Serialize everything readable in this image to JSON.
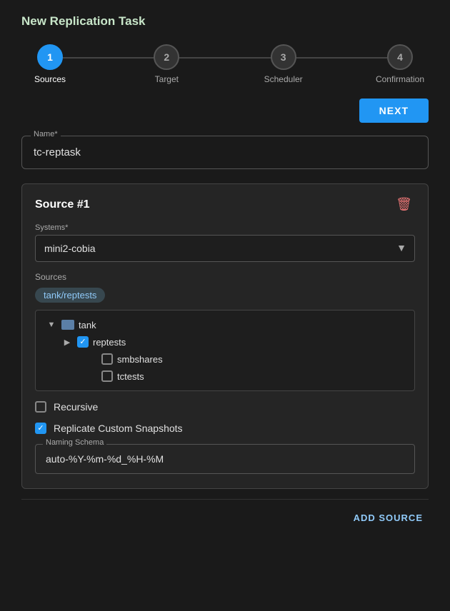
{
  "page": {
    "title": "New Replication Task"
  },
  "stepper": {
    "steps": [
      {
        "number": "1",
        "label": "Sources",
        "active": true
      },
      {
        "number": "2",
        "label": "Target",
        "active": false
      },
      {
        "number": "3",
        "label": "Scheduler",
        "active": false
      },
      {
        "number": "4",
        "label": "Confirmation",
        "active": false
      }
    ]
  },
  "toolbar": {
    "next_label": "NEXT"
  },
  "name_field": {
    "label": "Name*",
    "value": "tc-reptask"
  },
  "source_card": {
    "title": "Source #1",
    "systems_label": "Systems*",
    "systems_value": "mini2-cobia",
    "sources_label": "Sources",
    "source_tag": "tank/reptests",
    "tree": [
      {
        "level": 1,
        "toggle": "▼",
        "type": "folder",
        "label": "tank",
        "checked": false,
        "indeterminate": true
      },
      {
        "level": 2,
        "toggle": "▶",
        "type": "check",
        "label": "reptests",
        "checked": true
      },
      {
        "level": 2,
        "toggle": "",
        "type": "check",
        "label": "smbshares",
        "checked": false
      },
      {
        "level": 2,
        "toggle": "",
        "type": "check",
        "label": "tctests",
        "checked": false
      }
    ],
    "recursive_label": "Recursive",
    "recursive_checked": false,
    "replicate_snapshots_label": "Replicate Custom Snapshots",
    "replicate_snapshots_checked": true,
    "naming_schema_label": "Naming Schema",
    "naming_schema_value": "auto-%Y-%m-%d_%H-%M",
    "trash_icon": "🗑"
  },
  "add_source": {
    "label": "ADD SOURCE"
  }
}
